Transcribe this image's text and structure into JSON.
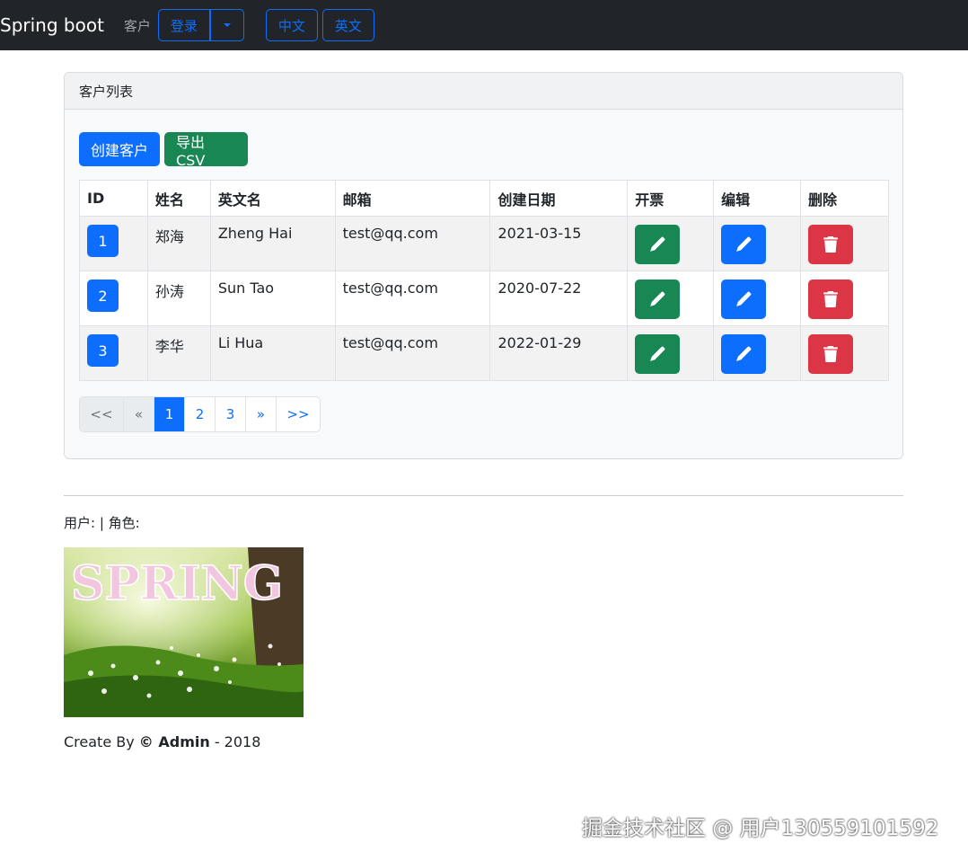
{
  "navbar": {
    "brand": "Spring boot",
    "customer_label": "客户",
    "login_label": "登录",
    "lang_cn": "中文",
    "lang_en": "英文"
  },
  "card": {
    "header": "客户列表",
    "create_label": "创建客户",
    "export_label": "导出 CSV",
    "columns": [
      "ID",
      "姓名",
      "英文名",
      "邮箱",
      "创建日期",
      "开票",
      "编辑",
      "删除"
    ],
    "rows": [
      {
        "id": "1",
        "name": "郑海",
        "english_name": "Zheng Hai",
        "email": "test@qq.com",
        "date": "2021-03-15"
      },
      {
        "id": "2",
        "name": "孙涛",
        "english_name": "Sun Tao",
        "email": "test@qq.com",
        "date": "2020-07-22"
      },
      {
        "id": "3",
        "name": "李华",
        "english_name": "Li Hua",
        "email": "test@qq.com",
        "date": "2022-01-29"
      }
    ],
    "pagination": {
      "first": "<<",
      "prev": "«",
      "pages": [
        "1",
        "2",
        "3"
      ],
      "current": "1",
      "next": "»",
      "last": ">>"
    }
  },
  "user_line": "用户: | 角色:",
  "image_text": "SPRING",
  "footer": {
    "prefix": "Create By ",
    "author": "© Admin",
    "suffix": " - 2018"
  },
  "watermark": "掘金技术社区 @ 用户130559101592",
  "colors": {
    "navbar": "#212529",
    "primary": "#0d6efd",
    "success": "#198754",
    "danger": "#dc3545"
  },
  "icons": [
    "caret-down-icon",
    "pencil-icon",
    "trash-icon"
  ]
}
